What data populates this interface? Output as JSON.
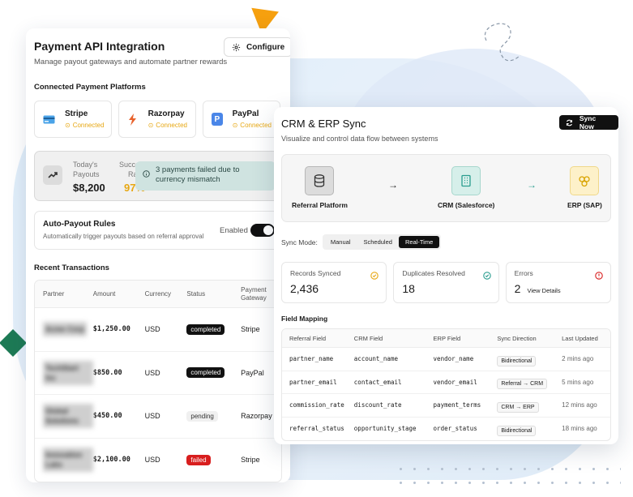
{
  "payment": {
    "title": "Payment API Integration",
    "subtitle": "Manage payout gateways and automate partner rewards",
    "configure_label": "Configure",
    "platforms_heading": "Connected Payment Platforms",
    "platforms": [
      {
        "name": "Stripe",
        "status": "Connected",
        "icon": "card-icon",
        "color": "#2f8fd8"
      },
      {
        "name": "Razorpay",
        "status": "Connected",
        "icon": "lightning-icon",
        "color": "#e8622c"
      },
      {
        "name": "PayPal",
        "status": "Connected",
        "icon": "paypal-icon",
        "color": "#2f6ed8"
      }
    ],
    "stats": {
      "payouts_label_1": "Today's",
      "payouts_label_2": "Payouts",
      "payouts_value": "$8,200",
      "success_label_1": "Success",
      "success_label_2": "Rate",
      "success_value": "97%"
    },
    "toast": "3 payments failed due to currency mismatch",
    "autopay": {
      "title": "Auto-Payout Rules",
      "subtitle": "Automatically trigger payouts based on referral approval",
      "enabled_label": "Enabled",
      "enabled": true
    },
    "transactions_heading": "Recent Transactions",
    "tx_columns": [
      "Partner",
      "Amount",
      "Currency",
      "Status",
      "Payment Gateway"
    ],
    "transactions": [
      {
        "partner": "Acme Corp",
        "amount": "$1,250.00",
        "currency": "USD",
        "status": "completed",
        "gateway": "Stripe"
      },
      {
        "partner": "TechStart Inc",
        "amount": "$850.00",
        "currency": "USD",
        "status": "completed",
        "gateway": "PayPal"
      },
      {
        "partner": "Global Solutions",
        "amount": "$450.00",
        "currency": "USD",
        "status": "pending",
        "gateway": "Razorpay"
      },
      {
        "partner": "Innovation Labs",
        "amount": "$2,100.00",
        "currency": "USD",
        "status": "failed",
        "gateway": "Stripe"
      }
    ]
  },
  "crm": {
    "title": "CRM & ERP Sync",
    "subtitle": "Visualize and control data flow between systems",
    "sync_now_label": "Sync Now",
    "nodes": [
      "Referral Platform",
      "CRM (Salesforce)",
      "ERP (SAP)"
    ],
    "sync_mode_label": "Sync Mode:",
    "sync_modes": [
      "Manual",
      "Scheduled",
      "Real-Time"
    ],
    "active_mode": "Real-Time",
    "cards": {
      "records_label": "Records Synced",
      "records_value": "2,436",
      "duplicates_label": "Duplicates Resolved",
      "duplicates_value": "18",
      "errors_label": "Errors",
      "errors_value": "2",
      "view_details": "View Details"
    },
    "mapping_heading": "Field Mapping",
    "mapping_columns": [
      "Referral Field",
      "CRM Field",
      "ERP Field",
      "Sync Direction",
      "Last Updated"
    ],
    "mappings": [
      {
        "referral": "partner_name",
        "crm": "account_name",
        "erp": "vendor_name",
        "direction": "Bidirectional",
        "updated": "2 mins ago"
      },
      {
        "referral": "partner_email",
        "crm": "contact_email",
        "erp": "vendor_email",
        "direction": "Referral → CRM",
        "updated": "5 mins ago"
      },
      {
        "referral": "commission_rate",
        "crm": "discount_rate",
        "erp": "payment_terms",
        "direction": "CRM → ERP",
        "updated": "12 mins ago"
      },
      {
        "referral": "referral_status",
        "crm": "opportunity_stage",
        "erp": "order_status",
        "direction": "Bidirectional",
        "updated": "18 mins ago"
      }
    ]
  },
  "colors": {
    "accent_yellow": "#e7a712",
    "success_teal": "#2a9d8f",
    "error_red": "#d81e1e",
    "toast_bg": "#cfe3e0"
  }
}
